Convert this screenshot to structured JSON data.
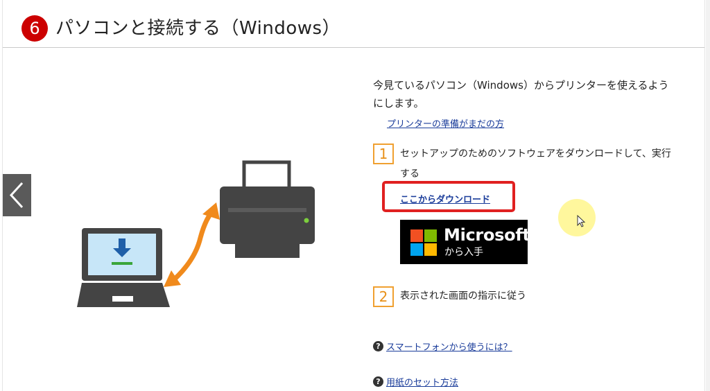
{
  "header": {
    "step_number": "6",
    "title": "パソコンと接続する（Windows）"
  },
  "content": {
    "intro": "今見ているパソコン（Windows）からプリンターを使えるようにします。",
    "prep_link": "プリンターの準備がまだの方",
    "steps": [
      {
        "number": "1",
        "text": "セットアップのためのソフトウェアをダウンロードして、実行する"
      },
      {
        "number": "2",
        "text": "表示された画面の指示に従う"
      }
    ],
    "download_link": "ここからダウンロード",
    "ms_store_badge": {
      "name": "Microsoft",
      "sub": "から入手"
    }
  },
  "help_links": [
    {
      "icon": "question-icon",
      "label": "スマートフォンから使うには？"
    },
    {
      "icon": "question-icon",
      "label": "用紙のセット方法"
    }
  ],
  "nav": {
    "prev_icon": "chevron-left-icon"
  },
  "illustration": {
    "icons": [
      "laptop-icon",
      "download-icon",
      "printer-icon",
      "double-arrow-icon"
    ]
  },
  "colors": {
    "accent": "#cc0000",
    "step_border": "#f0a030",
    "link": "#1a3c9a",
    "highlight": "#e02020",
    "arrow": "#f08a1c"
  }
}
